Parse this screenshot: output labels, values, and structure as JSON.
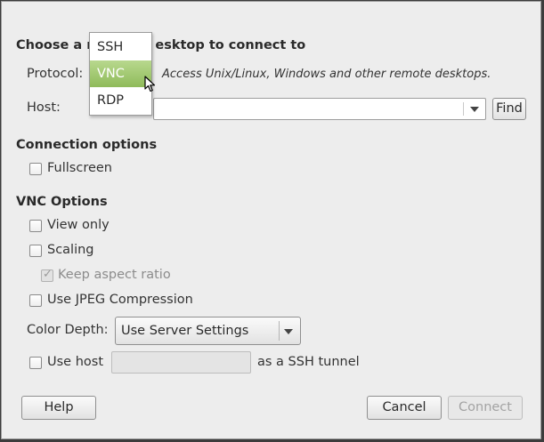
{
  "dialog": {
    "heading_prefix": "Choose a r",
    "heading_suffix": "esktop to connect to"
  },
  "protocol": {
    "label": "Protocol:",
    "description": "Access Unix/Linux, Windows and other remote desktops.",
    "options": [
      "SSH",
      "VNC",
      "RDP"
    ],
    "selected": "VNC"
  },
  "host": {
    "label": "Host:",
    "value": "",
    "find_label": "Find"
  },
  "connection_options": {
    "heading": "Connection options",
    "fullscreen_label": "Fullscreen",
    "fullscreen_checked": false
  },
  "vnc_options": {
    "heading": "VNC Options",
    "view_only_label": "View only",
    "scaling_label": "Scaling",
    "keep_aspect_label": "Keep aspect ratio",
    "keep_aspect_checked": true,
    "jpeg_label": "Use JPEG Compression",
    "color_depth_label": "Color Depth:",
    "color_depth_value": "Use Server Settings",
    "use_host_label": "Use host",
    "ssh_tunnel_suffix": "as a SSH tunnel",
    "ssh_host_value": ""
  },
  "buttons": {
    "help": "Help",
    "cancel": "Cancel",
    "connect": "Connect"
  },
  "icons": {
    "checkmark": "✓",
    "mouse_pointer": "arrow-cursor-icon"
  },
  "colors": {
    "selection": "#9cc46a",
    "dialog_bg": "#ededed"
  }
}
